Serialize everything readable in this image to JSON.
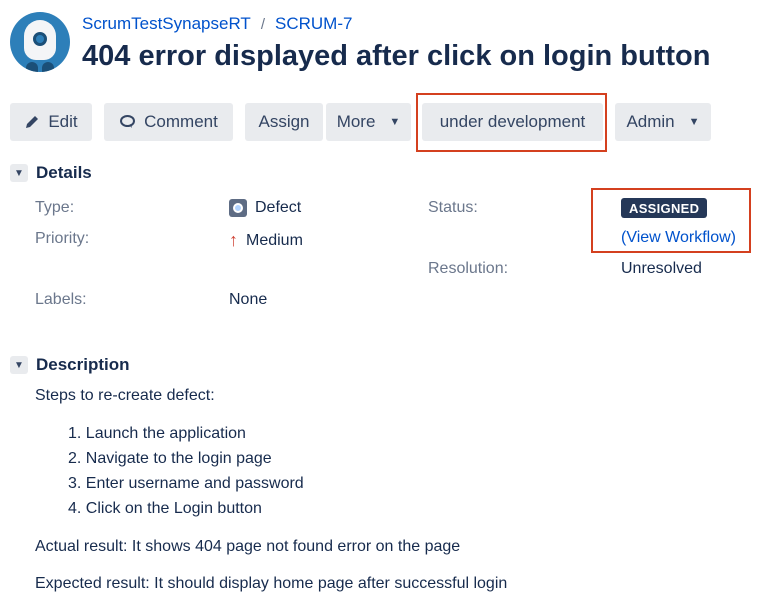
{
  "header": {
    "project": "ScrumTestSynapseRT",
    "separator": "/",
    "issue_key": "SCRUM-7",
    "title": "404 error displayed after click on login button"
  },
  "toolbar": {
    "edit": "Edit",
    "comment": "Comment",
    "assign": "Assign",
    "more": "More",
    "workflow_action": "under development",
    "admin": "Admin"
  },
  "details": {
    "heading": "Details",
    "type_label": "Type:",
    "type_value": "Defect",
    "priority_label": "Priority:",
    "priority_value": "Medium",
    "labels_label": "Labels:",
    "labels_value": "None",
    "status_label": "Status:",
    "status_value": "ASSIGNED",
    "view_workflow": "(View Workflow)",
    "resolution_label": "Resolution:",
    "resolution_value": "Unresolved"
  },
  "description": {
    "heading": "Description",
    "intro": "Steps to re-create defect:",
    "steps": [
      "1. Launch the application",
      "2. Navigate to the login page",
      "3. Enter username and password",
      "4. Click on the Login button"
    ],
    "actual": "Actual result: It shows 404 page not found error on the page",
    "expected": "Expected result: It should display home page after successful login"
  },
  "colors": {
    "link": "#0052cc",
    "highlight": "#d4401f",
    "status_lozenge": "#253858",
    "button_bg": "#e9ebee"
  }
}
